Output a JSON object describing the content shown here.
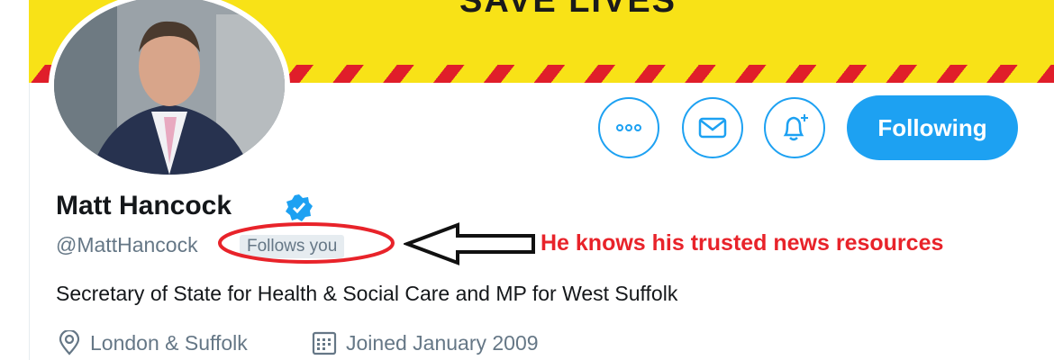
{
  "banner": {
    "text": "SAVE LIVES"
  },
  "buttons": {
    "more_icon": "more-icon",
    "message_icon": "mail-icon",
    "notify_icon": "bell-plus-icon",
    "follow_label": "Following"
  },
  "profile": {
    "name": "Matt Hancock",
    "handle": "@MattHancock",
    "follows_badge": "Follows you",
    "bio": "Secretary of State for Health & Social Care and MP for West Suffolk",
    "location": "London & Suffolk",
    "joined": "Joined January 2009"
  },
  "annotation": {
    "text": "He knows his trusted news resources"
  },
  "colors": {
    "accent": "#1da1f2",
    "annotation": "#e8232a",
    "banner_yellow": "#f8e217",
    "banner_red": "#e01e2a"
  }
}
